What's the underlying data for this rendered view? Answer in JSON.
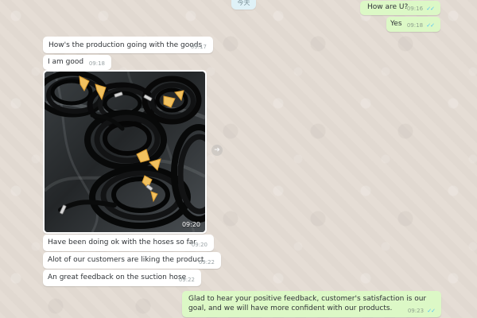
{
  "chat": {
    "date_chip": "今天",
    "messages": [
      {
        "text": "How are U?",
        "time": "09:16",
        "status": "✓✓"
      },
      {
        "text": "Yes",
        "time": "09:18",
        "status": "✓✓"
      },
      {
        "text": "How's the production going with the goods",
        "time": "09:17"
      },
      {
        "text": "I am good",
        "time": "09:18"
      },
      {
        "image_time": "09:20"
      },
      {
        "text": "Have  been  doing  ok with  the hoses  so far",
        "time": "09:20"
      },
      {
        "text": "Alot  of  our  customers are liking  the  product",
        "time": "09:22"
      },
      {
        "text": "An great  feedback on  the suction hose",
        "time": "09:22"
      },
      {
        "text": "Glad to hear your positive feedback, customer's satisfaction is our goal, and we will have more confident with our products.",
        "time": "09:23",
        "status": "✓✓"
      }
    ],
    "icons": {
      "forward": "share-arrow-icon"
    }
  }
}
